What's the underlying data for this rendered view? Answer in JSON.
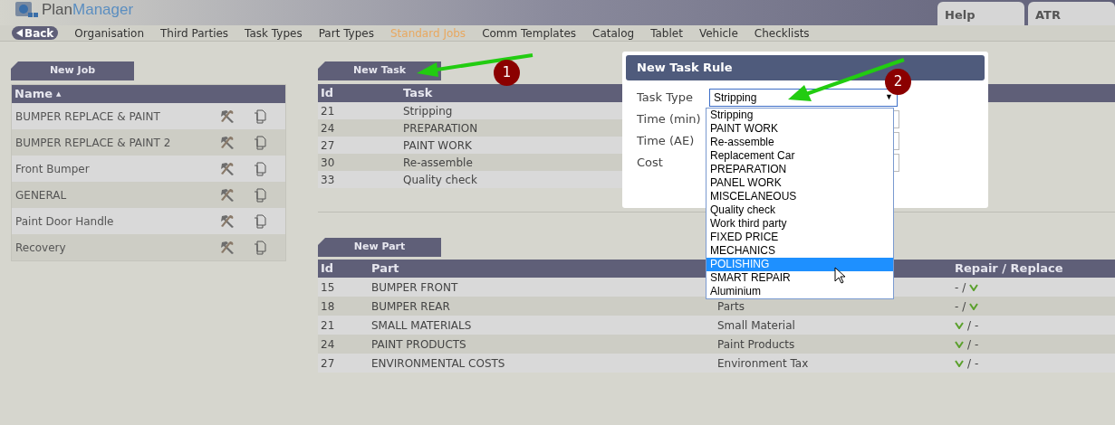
{
  "header": {
    "logo": {
      "first": "Plan",
      "second": "Manager"
    },
    "tabs": [
      {
        "label": "Help"
      },
      {
        "label": "ATR"
      }
    ]
  },
  "nav": {
    "back": "Back",
    "items": [
      {
        "label": "Organisation",
        "selected": false
      },
      {
        "label": "Third Parties",
        "selected": false
      },
      {
        "label": "Task Types",
        "selected": false
      },
      {
        "label": "Part Types",
        "selected": false
      },
      {
        "label": "Standard Jobs",
        "selected": true
      },
      {
        "label": "Comm Templates",
        "selected": false
      },
      {
        "label": "Catalog",
        "selected": false
      },
      {
        "label": "Tablet",
        "selected": false
      },
      {
        "label": "Vehicle",
        "selected": false
      },
      {
        "label": "Checklists",
        "selected": false
      }
    ]
  },
  "jobs": {
    "new_button": "New Job",
    "column": "Name",
    "sort_mark": "▲",
    "rows": [
      {
        "name": "BUMPER REPLACE & PAINT"
      },
      {
        "name": "BUMPER REPLACE & PAINT 2"
      },
      {
        "name": "Front Bumper"
      },
      {
        "name": "GENERAL"
      },
      {
        "name": "Paint Door Handle"
      },
      {
        "name": "Recovery"
      }
    ]
  },
  "tasks": {
    "new_button": "New Task",
    "columns": [
      "Id",
      "Task"
    ],
    "rows": [
      {
        "id": "21",
        "task": "Stripping"
      },
      {
        "id": "24",
        "task": "PREPARATION"
      },
      {
        "id": "27",
        "task": "PAINT WORK"
      },
      {
        "id": "30",
        "task": "Re-assemble"
      },
      {
        "id": "33",
        "task": "Quality check"
      }
    ]
  },
  "parts": {
    "new_button": "New Part",
    "columns": [
      "Id",
      "Part",
      "Repair / Replace"
    ],
    "separator": "/",
    "rows": [
      {
        "id": "15",
        "part": "BUMPER FRONT",
        "repair": {
          "checked": false,
          "text": "-"
        },
        "replace": {
          "checked": true
        }
      },
      {
        "id": "18",
        "part": "BUMPER REAR",
        "type": "Parts",
        "repair": {
          "checked": false,
          "text": "-"
        },
        "replace": {
          "checked": true
        }
      },
      {
        "id": "21",
        "part": "SMALL MATERIALS",
        "type": "Small Material",
        "repair": {
          "checked": true
        },
        "replace": {
          "checked": false,
          "text": "-"
        }
      },
      {
        "id": "24",
        "part": "PAINT PRODUCTS",
        "type": "Paint Products",
        "repair": {
          "checked": true
        },
        "replace": {
          "checked": false,
          "text": "-"
        }
      },
      {
        "id": "27",
        "part": "ENVIRONMENTAL COSTS",
        "type": "Environment Tax",
        "repair": {
          "checked": true
        },
        "replace": {
          "checked": false,
          "text": "-"
        }
      }
    ]
  },
  "dialog": {
    "title": "New Task Rule",
    "fields": [
      {
        "label": "Task Type",
        "kind": "select",
        "value": "Stripping",
        "arrow": "▼"
      },
      {
        "label": "Time (min)",
        "kind": "input"
      },
      {
        "label": "Time (AE)",
        "kind": "input"
      },
      {
        "label": "Cost",
        "kind": "input"
      }
    ],
    "options": [
      {
        "label": "Stripping",
        "selected": false
      },
      {
        "label": "PAINT WORK",
        "selected": false
      },
      {
        "label": "Re-assemble",
        "selected": false
      },
      {
        "label": "Replacement Car",
        "selected": false
      },
      {
        "label": "PREPARATION",
        "selected": false
      },
      {
        "label": "PANEL WORK",
        "selected": false
      },
      {
        "label": "MISCELANEOUS",
        "selected": false
      },
      {
        "label": "Quality check",
        "selected": false
      },
      {
        "label": "Work third party",
        "selected": false
      },
      {
        "label": "FIXED PRICE",
        "selected": false
      },
      {
        "label": "MECHANICS",
        "selected": false
      },
      {
        "label": "POLISHING",
        "selected": true
      },
      {
        "label": "SMART REPAIR",
        "selected": false
      },
      {
        "label": "Aluminium",
        "selected": false
      }
    ]
  },
  "annotations": [
    {
      "label": "1"
    },
    {
      "label": "2"
    }
  ]
}
